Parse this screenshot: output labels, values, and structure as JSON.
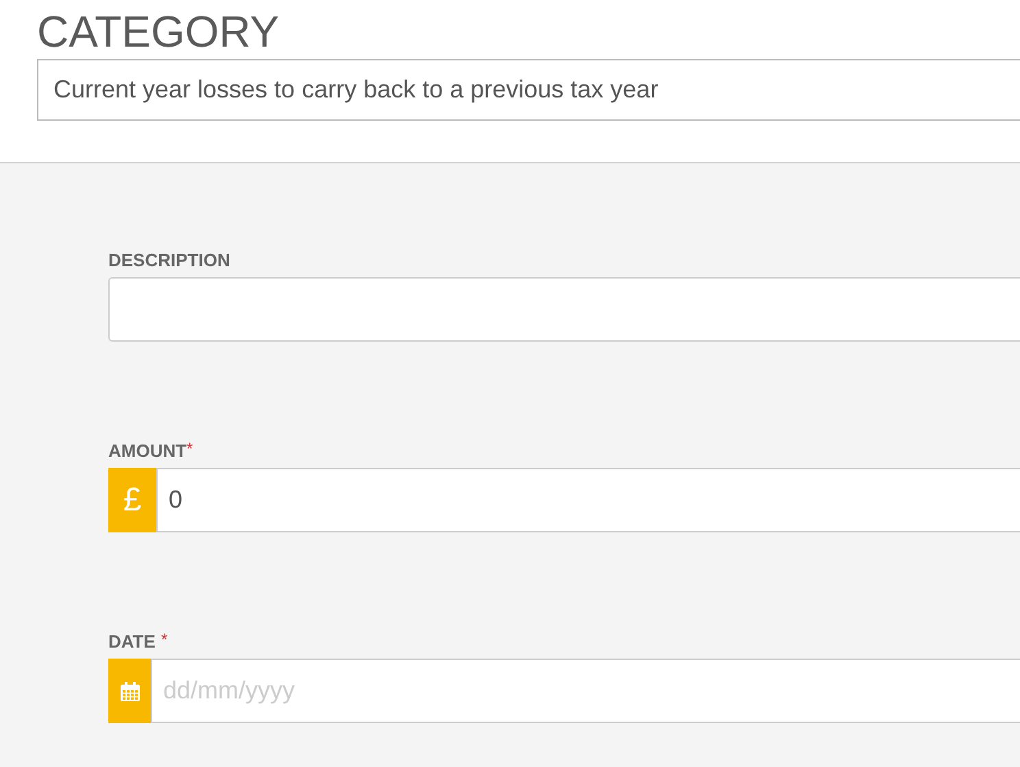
{
  "category": {
    "title": "CATEGORY",
    "value": "Current year losses to carry back to a previous tax year"
  },
  "fields": [
    {
      "kind": "text",
      "label": "DESCRIPTION"
    },
    {
      "kind": "currency",
      "label": "AMOUNT",
      "required_mark": "*",
      "prefix": "£",
      "value": "0"
    },
    {
      "kind": "date",
      "label": "DATE",
      "required_mark": "*",
      "placeholder": "dd/mm/yyyy"
    }
  ]
}
